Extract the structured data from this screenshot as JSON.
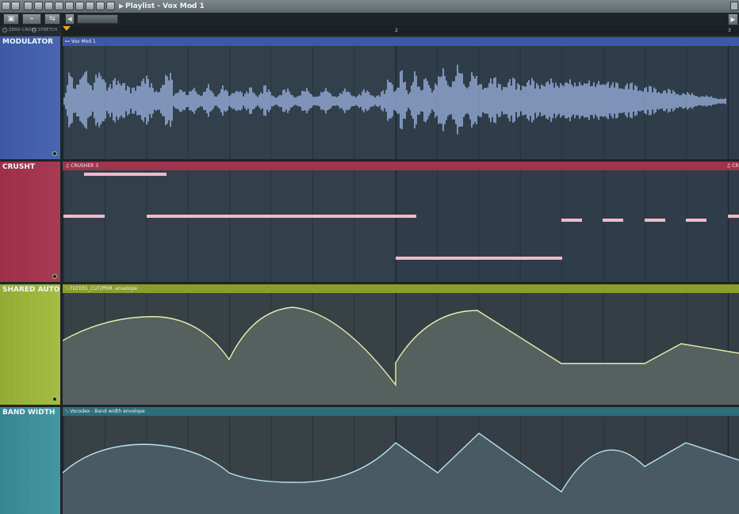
{
  "toolbar": {
    "title": "Playlist - Vox Mod 1",
    "dropdown_glyph": "▾",
    "arrow_glyph": "▶",
    "icons": [
      "snap-icon",
      "magnet-icon",
      "draw-icon",
      "paint-icon",
      "delete-icon",
      "mute-icon",
      "slip-icon",
      "select-icon",
      "zoom-icon",
      "play-icon",
      "playlist-icon",
      "close-icon"
    ]
  },
  "row2": {
    "buttons": [
      "▣",
      "⌁",
      "⇆"
    ],
    "scroll_right": "▶"
  },
  "options": {
    "zero_cross": "ZERO-CROSS",
    "stretch": "STRETCH"
  },
  "timeline": {
    "markers": [
      "2",
      "3"
    ]
  },
  "tracks": [
    {
      "name": "MODULATOR",
      "clip_title": "⊷ Vox Mod 1",
      "label_color": "#3f5aa7",
      "lane_color": "#2f3d4a",
      "clip_color": "#3e58a6",
      "kind": "audio"
    },
    {
      "name": "CRUSHT",
      "clip_title": "♫ CRUSHER 3",
      "clip_title_right": "♫ CR",
      "label_color": "#a3344e",
      "lane_color": "#2f3d4a",
      "clip_color": "#a3324e",
      "kind": "notes"
    },
    {
      "name": "SHARED AUTO",
      "clip_title": "⟍ FILTER1_CUT/PRM. envelope",
      "label_color": "#9db238",
      "lane_color": "#343e44",
      "clip_color": "#8c9d2d",
      "kind": "automation",
      "fill_color": "#56605e",
      "line_color": "#e5edb0"
    },
    {
      "name": "BAND WIDTH",
      "clip_title": "⟍ Vocodex - Band width envelope",
      "label_color": "#3e8f99",
      "lane_color": "#343e44",
      "clip_color": "#2e6e7c",
      "kind": "automation",
      "fill_color": "#4a5a63",
      "line_color": "#b7e3ef"
    }
  ]
}
